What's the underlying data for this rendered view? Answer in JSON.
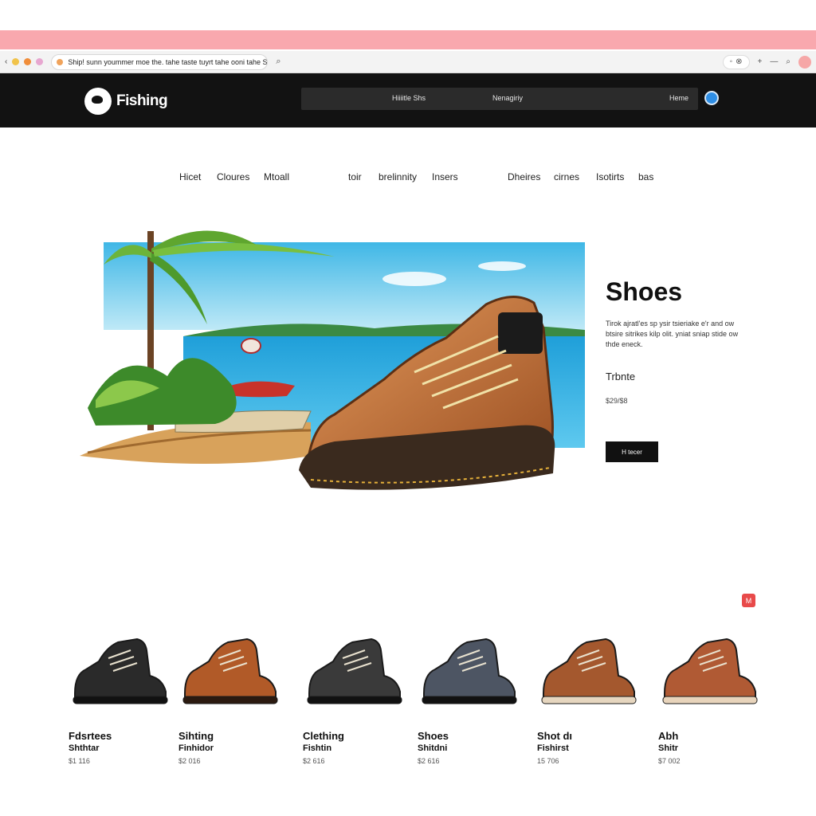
{
  "browser": {
    "tab_title": "Ship! sunn yoummer moe the. tahe taste tuyrt tahe ooni tahe Shoes",
    "back_glyph": "‹",
    "search_glyph": "⌕",
    "controls": [
      "◦",
      "⊗",
      "+",
      "—",
      "⌕"
    ]
  },
  "header": {
    "logo_text": "Fishing",
    "nav": [
      "Hiiiitle Shs",
      "Nenagiriy",
      "Heme"
    ]
  },
  "categories": [
    "Hicet",
    "Cloures",
    "Mtoall",
    "toir",
    "brelinnity",
    "Insers",
    "Dheires",
    "cirnes",
    "Isotirts",
    "bas"
  ],
  "hero": {
    "title": "Shoes",
    "description": "Tirok ajratl'es sp ysir tsieriake e'r and ow btsire sitrikes kilp olit. yniat sniap stide ow thde eneck.",
    "subtitle": "Trbnte",
    "price": "$29/$8",
    "button_label": "H tecer"
  },
  "badge_label": "M",
  "products": [
    {
      "name": "Fdsrtees",
      "sub": "Shthtar",
      "price": "$1 116",
      "color": "#2a2a2a",
      "sole": "#111111"
    },
    {
      "name": "Sihting",
      "sub": "Finhidor",
      "price": "$2 016",
      "color": "#b15a28",
      "sole": "#2b1a10"
    },
    {
      "name": "Clething",
      "sub": "Fishtin",
      "price": "$2 616",
      "color": "#3a3a3a",
      "sole": "#111111"
    },
    {
      "name": "Shoes",
      "sub": "Shitdni",
      "price": "$2 616",
      "color": "#4d5563",
      "sole": "#111111"
    },
    {
      "name": "Shot dı",
      "sub": "Fishirst",
      "price": "15 706",
      "color": "#a4582e",
      "sole": "#e6d6bf"
    },
    {
      "name": "Abh",
      "sub": "Shitr",
      "price": "$7 002",
      "color": "#b05a34",
      "sole": "#e8d4bb"
    }
  ],
  "colors": {
    "top_strip": "#f9a8ae",
    "header_bg": "#121212",
    "accent": "#e84a4a"
  }
}
